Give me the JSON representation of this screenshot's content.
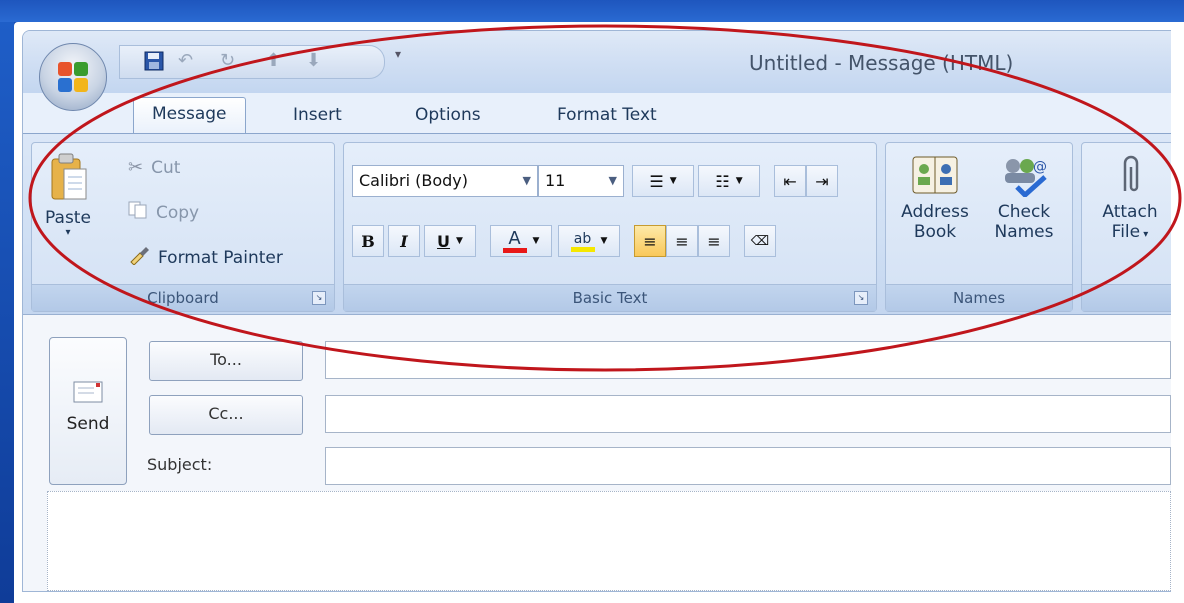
{
  "window": {
    "title": "Untitled - Message (HTML)"
  },
  "qat": {
    "more": "▾"
  },
  "tabs": [
    {
      "label": "Message",
      "active": true
    },
    {
      "label": "Insert",
      "active": false
    },
    {
      "label": "Options",
      "active": false
    },
    {
      "label": "Format Text",
      "active": false
    }
  ],
  "clipboard": {
    "paste": "Paste",
    "cut": "Cut",
    "copy": "Copy",
    "format_painter": "Format Painter",
    "label": "Clipboard"
  },
  "basic_text": {
    "font": "Calibri (Body)",
    "size": "11",
    "bold": "B",
    "italic": "I",
    "underline": "U",
    "font_color_glyph": "A",
    "highlight_glyph": "ab",
    "label": "Basic Text"
  },
  "names": {
    "address_book_1": "Address",
    "address_book_2": "Book",
    "check_names_1": "Check",
    "check_names_2": "Names",
    "label": "Names"
  },
  "attach": {
    "line1": "Attach",
    "line2": "File"
  },
  "form": {
    "to": "To...",
    "cc": "Cc...",
    "subject": "Subject:",
    "send": "Send"
  },
  "colors": {
    "font_color": "#e81818",
    "highlight": "#f5e700",
    "annotation": "#c0161c"
  }
}
